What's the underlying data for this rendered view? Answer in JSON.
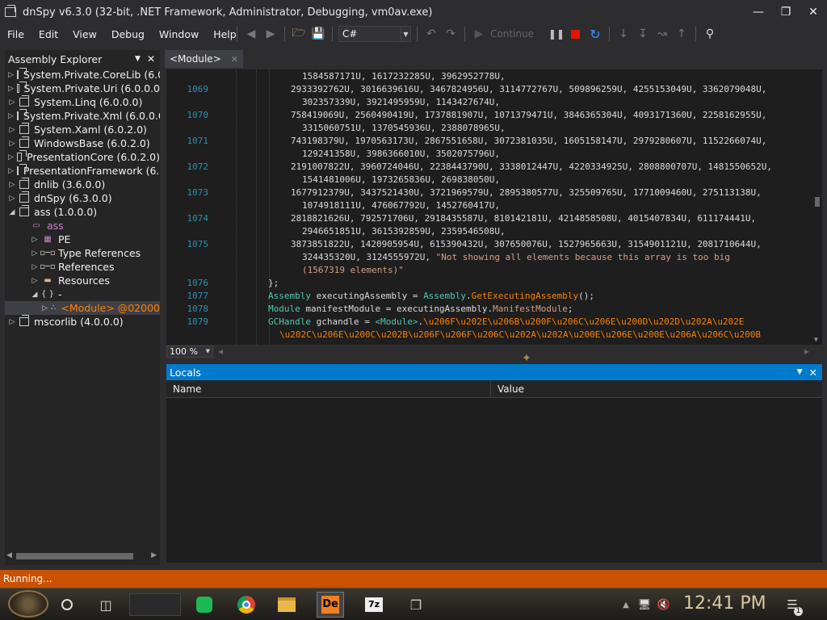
{
  "window": {
    "title": "dnSpy v6.3.0 (32-bit, .NET Framework, Administrator, Debugging, vm0av.exe)",
    "controls": [
      "minimize-icon",
      "restore-icon",
      "close-icon"
    ]
  },
  "menu": [
    "File",
    "Edit",
    "View",
    "Debug",
    "Window",
    "Help"
  ],
  "toolbar": {
    "language": "C#",
    "continue_label": "Continue"
  },
  "assembly_explorer": {
    "title": "Assembly Explorer",
    "items": [
      {
        "label": "System.Private.CoreLib (6.0",
        "level": 0,
        "expander": "collapsed",
        "icon": "assembly-icon"
      },
      {
        "label": "System.Private.Uri (6.0.0.0",
        "level": 0,
        "expander": "collapsed",
        "icon": "assembly-icon"
      },
      {
        "label": "System.Linq (6.0.0.0)",
        "level": 0,
        "expander": "collapsed",
        "icon": "assembly-icon"
      },
      {
        "label": "System.Private.Xml (6.0.0.0",
        "level": 0,
        "expander": "collapsed",
        "icon": "assembly-icon"
      },
      {
        "label": "System.Xaml (6.0.2.0)",
        "level": 0,
        "expander": "collapsed",
        "icon": "assembly-icon"
      },
      {
        "label": "WindowsBase (6.0.2.0)",
        "level": 0,
        "expander": "collapsed",
        "icon": "assembly-icon"
      },
      {
        "label": "PresentationCore (6.0.2.0)",
        "level": 0,
        "expander": "collapsed",
        "icon": "assembly-icon"
      },
      {
        "label": "PresentationFramework (6.0",
        "level": 0,
        "expander": "collapsed",
        "icon": "assembly-icon"
      },
      {
        "label": "dnlib (3.6.0.0)",
        "level": 0,
        "expander": "collapsed",
        "icon": "assembly-icon"
      },
      {
        "label": "dnSpy (6.3.0.0)",
        "level": 0,
        "expander": "collapsed",
        "icon": "assembly-icon"
      },
      {
        "label": "ass (1.0.0.0)",
        "level": 0,
        "expander": "expanded",
        "icon": "assembly-icon"
      },
      {
        "label": "ass",
        "level": 1,
        "expander": "none",
        "icon": "module-icon",
        "color": "#c586c0"
      },
      {
        "label": "PE",
        "level": 2,
        "expander": "collapsed",
        "icon": "pe-icon"
      },
      {
        "label": "Type References",
        "level": 2,
        "expander": "collapsed",
        "icon": "reference-icon"
      },
      {
        "label": "References",
        "level": 2,
        "expander": "collapsed",
        "icon": "reference-icon"
      },
      {
        "label": "Resources",
        "level": 2,
        "expander": "collapsed",
        "icon": "folder-icon"
      },
      {
        "label": "-",
        "level": 2,
        "expander": "expanded",
        "icon": "namespace-icon"
      },
      {
        "label": "<Module> @02000",
        "level": 3,
        "expander": "collapsed",
        "icon": "class-icon",
        "color": "#ff8000",
        "selected": true
      },
      {
        "label": "mscorlib (4.0.0.0)",
        "level": 0,
        "expander": "collapsed",
        "icon": "assembly-icon"
      }
    ]
  },
  "editor": {
    "tab_label": "<Module>",
    "zoom": "100 %",
    "lines": [
      {
        "num": "",
        "indent": 1,
        "segs": [
          {
            "t": "1584587171U, 1617232285U, 3962952778U,",
            "c": ""
          }
        ]
      },
      {
        "num": "1069",
        "indent": 0,
        "segs": [
          {
            "t": "2933392762U, 3016639616U, 3467824956U, 3114772767U, 509896259U, 4255153049U, 3362079048U,",
            "c": ""
          }
        ]
      },
      {
        "num": "",
        "indent": 1,
        "segs": [
          {
            "t": "302357339U, 3921495959U, 1143427674U,",
            "c": ""
          }
        ]
      },
      {
        "num": "1070",
        "indent": 0,
        "segs": [
          {
            "t": "758419069U, 2560490419U, 1737881907U, 1071379471U, 3846365304U, 4093171360U, 2258162955U,",
            "c": ""
          }
        ]
      },
      {
        "num": "",
        "indent": 1,
        "segs": [
          {
            "t": "3315060751U, 1370545936U, 2388078965U,",
            "c": ""
          }
        ]
      },
      {
        "num": "1071",
        "indent": 0,
        "segs": [
          {
            "t": "743198379U, 1970563173U, 2867551658U, 3072381035U, 1605158147U, 2979280607U, 1152266074U,",
            "c": ""
          }
        ]
      },
      {
        "num": "",
        "indent": 1,
        "segs": [
          {
            "t": "129241358U, 3986366010U, 3502075796U,",
            "c": ""
          }
        ]
      },
      {
        "num": "1072",
        "indent": 0,
        "segs": [
          {
            "t": "2191007822U, 3960724046U, 2238443790U, 3338012447U, 4220334925U, 2808800707U, 1481550652U,",
            "c": ""
          }
        ]
      },
      {
        "num": "",
        "indent": 1,
        "segs": [
          {
            "t": "1541481006U, 1973265836U, 269838050U,",
            "c": ""
          }
        ]
      },
      {
        "num": "1073",
        "indent": 0,
        "segs": [
          {
            "t": "1677912379U, 3437521430U, 3721969579U, 2895380577U, 325509765U, 1771009460U, 275113138U,",
            "c": ""
          }
        ]
      },
      {
        "num": "",
        "indent": 1,
        "segs": [
          {
            "t": "1074918111U, 476067792U, 1452760417U,",
            "c": ""
          }
        ]
      },
      {
        "num": "1074",
        "indent": 0,
        "segs": [
          {
            "t": "2818821626U, 792571706U, 2918435587U, 810142181U, 4214858508U, 4015407834U, 611174441U,",
            "c": ""
          }
        ]
      },
      {
        "num": "",
        "indent": 1,
        "segs": [
          {
            "t": "2946651851U, 3615392859U, 2359546508U,",
            "c": ""
          }
        ]
      },
      {
        "num": "1075",
        "indent": 0,
        "segs": [
          {
            "t": "3873851822U, 1420905954U, 615390432U, 307650076U, 1527965663U, 3154901121U, 2081710644U,",
            "c": ""
          }
        ]
      },
      {
        "num": "",
        "indent": 1,
        "segs": [
          {
            "t": "324435320U, 3124555972U, ",
            "c": ""
          },
          {
            "t": "\"Not showing all elements because this array is too big",
            "c": "str"
          }
        ]
      },
      {
        "num": "",
        "indent": 1,
        "segs": [
          {
            "t": "(1567319 elements)\"",
            "c": "str"
          }
        ]
      },
      {
        "num": "1076",
        "indent": -1,
        "segs": [
          {
            "t": "};",
            "c": ""
          }
        ]
      },
      {
        "num": "1077",
        "indent": -1,
        "segs": [
          {
            "t": "Assembly",
            "c": "kw-type"
          },
          {
            "t": " executingAssembly = ",
            "c": ""
          },
          {
            "t": "Assembly",
            "c": "kw-type"
          },
          {
            "t": ".",
            "c": ""
          },
          {
            "t": "GetExecutingAssembly",
            "c": "kw-method"
          },
          {
            "t": "();",
            "c": ""
          }
        ]
      },
      {
        "num": "1078",
        "indent": -1,
        "segs": [
          {
            "t": "Module",
            "c": "kw-type"
          },
          {
            "t": " manifestModule = executingAssembly.",
            "c": ""
          },
          {
            "t": "ManifestModule",
            "c": "kw-prop"
          },
          {
            "t": ";",
            "c": ""
          }
        ]
      },
      {
        "num": "1079",
        "indent": -1,
        "segs": [
          {
            "t": "GCHandle",
            "c": "kw-type"
          },
          {
            "t": " gchandle = ",
            "c": ""
          },
          {
            "t": "<Module>",
            "c": "kw-type"
          },
          {
            "t": ".",
            "c": ""
          },
          {
            "t": "\\u206F\\u202E\\u206B\\u200F\\u206C\\u206E\\u200D\\u202D\\u202A\\u202E",
            "c": "orange"
          }
        ]
      },
      {
        "num": "",
        "indent": -2,
        "segs": [
          {
            "t": "\\u202C\\u206E\\u200C\\u202B\\u206F\\u206F\\u206C\\u202A\\u202A\\u200E\\u206E\\u200E\\u206A\\u206C\\u200B",
            "c": "orange"
          }
        ]
      }
    ]
  },
  "locals": {
    "title": "Locals",
    "columns": [
      "Name",
      "Value"
    ]
  },
  "status": "Running...",
  "taskbar": {
    "time": "12:41 PM",
    "apps": [
      "cortana-icon",
      "task-view-icon",
      "spotify-icon",
      "chrome-icon",
      "file-explorer-icon",
      "dnspy-icon",
      "7zip-icon",
      "vm-icon"
    ],
    "notification_count": "1"
  }
}
